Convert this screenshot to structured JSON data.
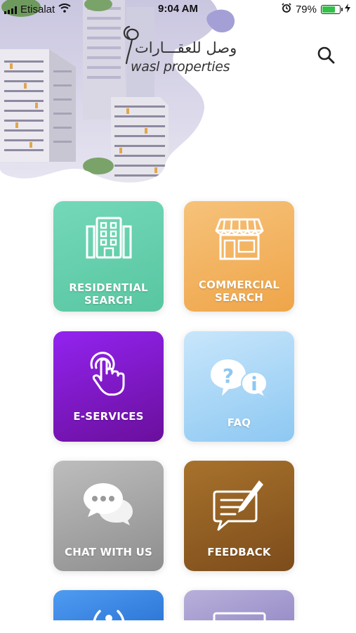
{
  "status_bar": {
    "carrier": "Etisalat",
    "time": "9:04 AM",
    "battery_percent": "79%",
    "battery_level": 0.79,
    "icons": [
      "signal-icon",
      "wifi-icon",
      "alarm-icon",
      "battery-icon",
      "charging-icon"
    ]
  },
  "header": {
    "logo_arabic": "وصل للعقـــارات",
    "logo_latin": "wasl properties",
    "search_icon": "search-icon"
  },
  "tiles": [
    {
      "label_line1": "RESIDENTIAL",
      "label_line2": "SEARCH",
      "icon": "building-icon",
      "color": "#66cfad"
    },
    {
      "label_line1": "COMMERCIAL",
      "label_line2": "SEARCH",
      "icon": "shop-icon",
      "color": "#f2b35f"
    },
    {
      "label_line1": "E-SERVICES",
      "label_line2": "",
      "icon": "tap-hand-icon",
      "color": "#7e19c8"
    },
    {
      "label_line1": "FAQ",
      "label_line2": "",
      "icon": "question-info-bubbles-icon",
      "color": "#a9d6f6"
    },
    {
      "label_line1": "CHAT WITH US",
      "label_line2": "",
      "icon": "chat-bubbles-icon",
      "color": "#a6a6a6"
    },
    {
      "label_line1": "FEEDBACK",
      "label_line2": "",
      "icon": "feedback-pen-icon",
      "color": "#925f24"
    },
    {
      "label_line1": "",
      "label_line2": "",
      "icon": "signal-broadcast-icon",
      "color": "#3f8ae6"
    },
    {
      "label_line1": "",
      "label_line2": "",
      "icon": "mail-icon",
      "color": "#a99fd1"
    }
  ]
}
